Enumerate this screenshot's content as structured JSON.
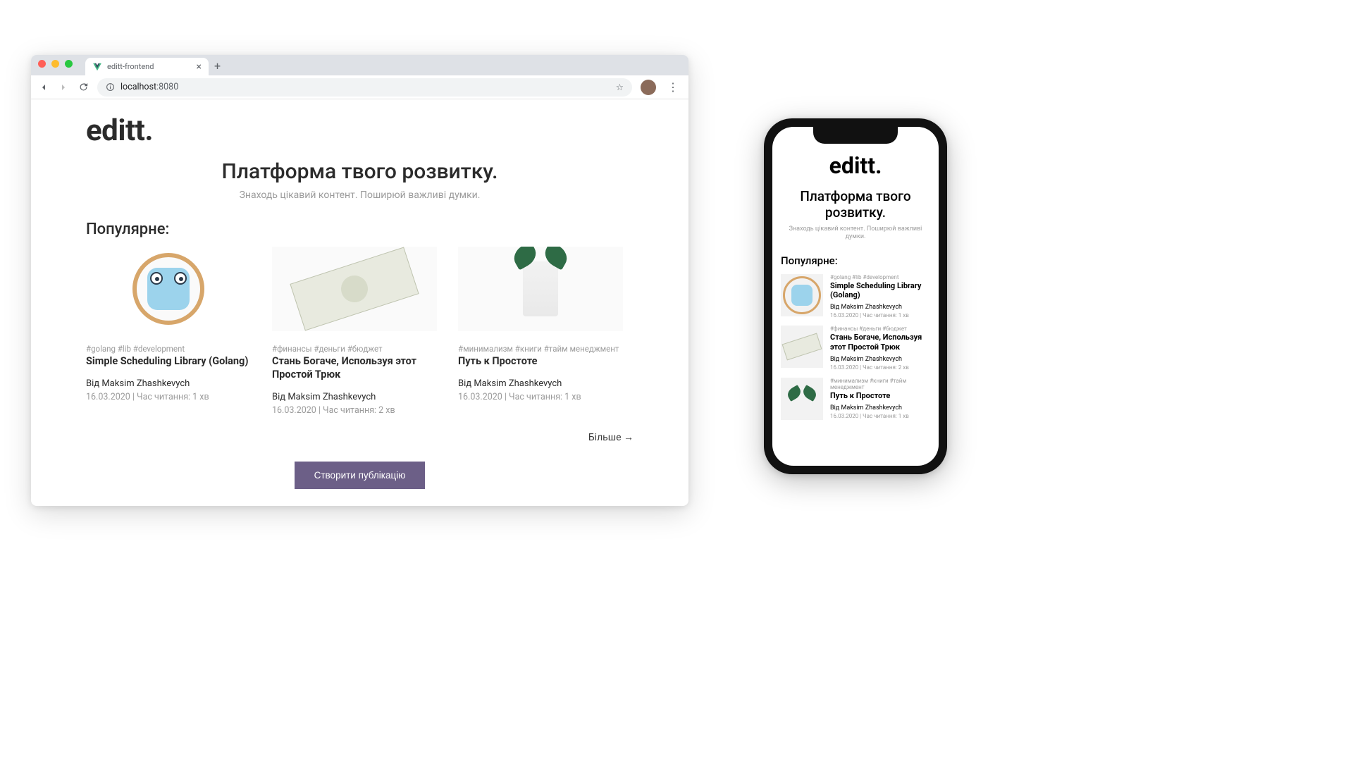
{
  "browser": {
    "tab_title": "editt-frontend",
    "url_host": "localhost",
    "url_path": ":8080"
  },
  "site": {
    "logo": "editt.",
    "hero_title": "Платформа твого розвитку.",
    "hero_sub": "Знаходь цікавий контент. Поширюй важливі думки.",
    "section_title": "Популярне:",
    "more_label": "Більше →",
    "cta_label": "Створити публікацію"
  },
  "cards": [
    {
      "tags": "#golang #lib #development",
      "title": "Simple Scheduling Library (Golang)",
      "author": "Від Maksim Zhashkevych",
      "meta": "16.03.2020 | Час читання: 1 хв"
    },
    {
      "tags": "#финансы #деньги #бюджет",
      "title": "Стань Богаче, Используя этот Простой Трюк",
      "author": "Від Maksim Zhashkevych",
      "meta": "16.03.2020 | Час читання: 2 хв"
    },
    {
      "tags": "#минимализм #книги #тайм менеджмент",
      "title": "Путь к Простоте",
      "author": "Від Maksim Zhashkevych",
      "meta": "16.03.2020 | Час читання: 1 хв"
    }
  ],
  "phone": {
    "logo": "editt.",
    "hero_title": "Платформа твого розвитку.",
    "hero_sub": "Знаходь цікавий контент. Поширюй важливі думки.",
    "section_title": "Популярне:",
    "items": [
      {
        "tags": "#golang #lib #development",
        "title": "Simple Scheduling Library (Golang)",
        "author": "Від Maksim Zhashkevych",
        "meta": "16.03.2020 | Час читання: 1 хв"
      },
      {
        "tags": "#финансы #деньги #бюджет",
        "title": "Стань Богаче, Используя этот Простой Трюк",
        "author": "Від Maksim Zhashkevych",
        "meta": "16.03.2020 | Час читання: 2 хв"
      },
      {
        "tags": "#минимализм #книги #тайм менеджмент",
        "title": "Путь к Простоте",
        "author": "Від Maksim Zhashkevych",
        "meta": "16.03.2020 | Час читання: 1 хв"
      }
    ]
  }
}
